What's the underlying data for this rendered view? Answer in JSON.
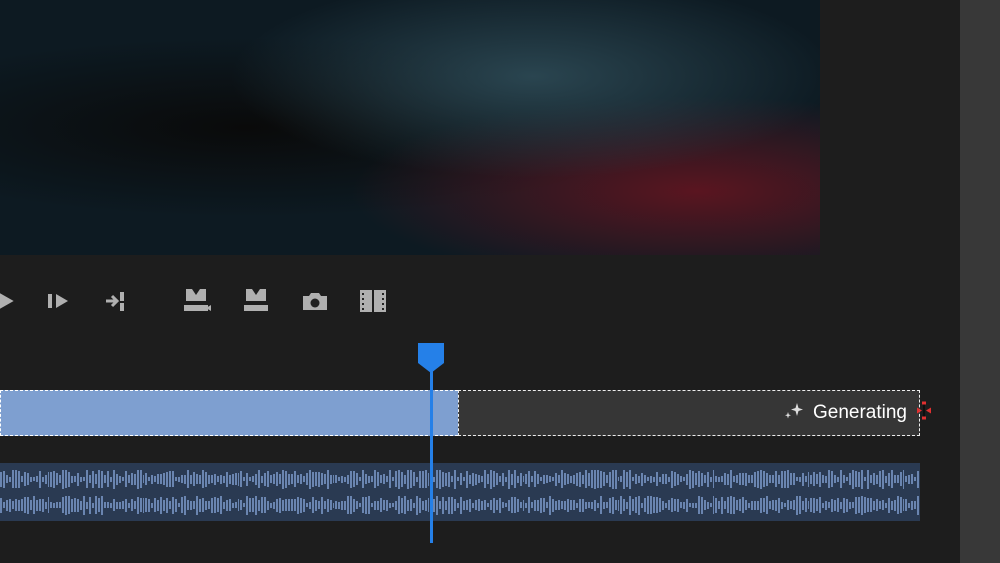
{
  "toolbar": {
    "play_label": "Play",
    "step_forward_label": "Step Forward",
    "next_edit_label": "Go to Next Edit Point",
    "insert_label": "Insert",
    "overwrite_label": "Overwrite",
    "snapshot_label": "Export Frame",
    "comparison_label": "Comparison View"
  },
  "timeline": {
    "generating_label": "Generating",
    "sparkle_icon": "sparkle-icon"
  },
  "colors": {
    "playhead": "#2580e8",
    "video_clip": "#7e9fd0",
    "audio_track": "#2a3a52",
    "trim_cursor": "#e03030"
  }
}
